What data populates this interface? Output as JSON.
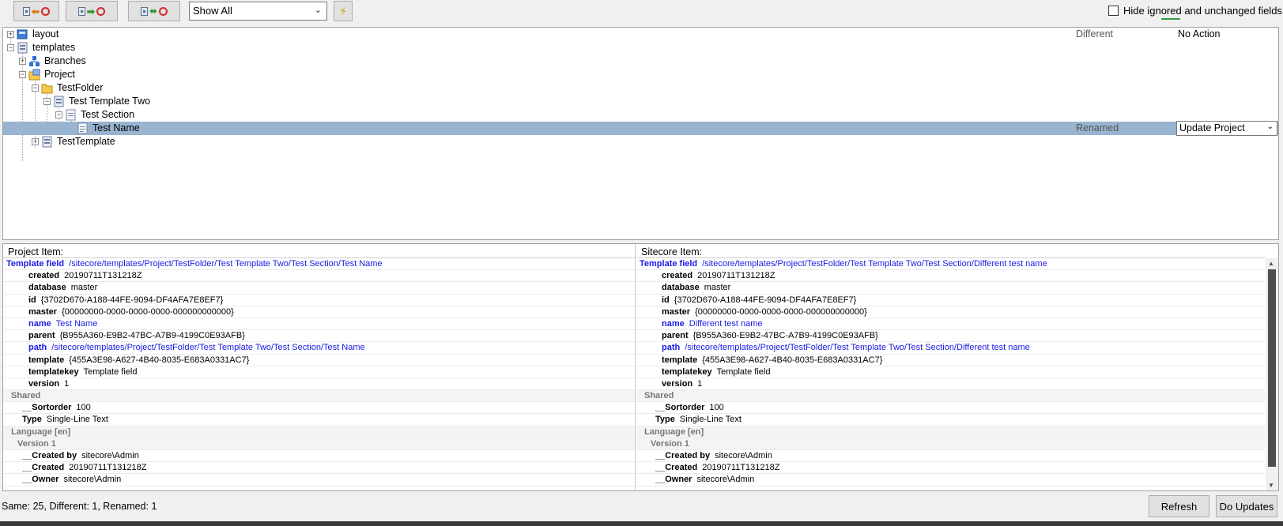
{
  "toolbar": {
    "filter_value": "Show All",
    "hide_label": "Hide ignored and unchanged fields"
  },
  "tree": {
    "rows": [
      {
        "label": "layout",
        "status": "Different",
        "action": "No Action"
      },
      {
        "label": "templates"
      },
      {
        "label": "Branches"
      },
      {
        "label": "Project"
      },
      {
        "label": "TestFolder"
      },
      {
        "label": "Test Template Two"
      },
      {
        "label": "Test Section"
      },
      {
        "label": "Test Name",
        "status": "Renamed",
        "action": "Update Project"
      },
      {
        "label": "TestTemplate"
      }
    ]
  },
  "left": {
    "header": "Project Item:",
    "rows": [
      {
        "k": "Template field",
        "v": "/sitecore/templates/Project/TestFolder/Test Template Two/Test Section/Test Name"
      },
      {
        "k": "created",
        "v": "20190711T131218Z"
      },
      {
        "k": "database",
        "v": "master"
      },
      {
        "k": "id",
        "v": "{3702D670-A188-44FE-9094-DF4AFA7E8EF7}"
      },
      {
        "k": "master",
        "v": "{00000000-0000-0000-0000-000000000000}"
      },
      {
        "k": "name",
        "v": "Test Name"
      },
      {
        "k": "parent",
        "v": "{B955A360-E9B2-47BC-A7B9-4199C0E93AFB}"
      },
      {
        "k": "path",
        "v": "/sitecore/templates/Project/TestFolder/Test Template Two/Test Section/Test Name"
      },
      {
        "k": "template",
        "v": "{455A3E98-A627-4B40-8035-E683A0331AC7}"
      },
      {
        "k": "templatekey",
        "v": "Template field"
      },
      {
        "k": "version",
        "v": "1"
      },
      {
        "k": "Shared",
        "v": ""
      },
      {
        "k": "__Sortorder",
        "v": "100"
      },
      {
        "k": "Type",
        "v": "Single-Line Text"
      },
      {
        "k": "Language [en]",
        "v": ""
      },
      {
        "k": "Version 1",
        "v": ""
      },
      {
        "k": "__Created by",
        "v": "sitecore\\Admin"
      },
      {
        "k": "__Created",
        "v": "20190711T131218Z"
      },
      {
        "k": "__Owner",
        "v": "sitecore\\Admin"
      }
    ]
  },
  "right": {
    "header": "Sitecore Item:",
    "rows": [
      {
        "k": "Template field",
        "v": "/sitecore/templates/Project/TestFolder/Test Template Two/Test Section/Different test name"
      },
      {
        "k": "created",
        "v": "20190711T131218Z"
      },
      {
        "k": "database",
        "v": "master"
      },
      {
        "k": "id",
        "v": "{3702D670-A188-44FE-9094-DF4AFA7E8EF7}"
      },
      {
        "k": "master",
        "v": "{00000000-0000-0000-0000-000000000000}"
      },
      {
        "k": "name",
        "v": "Different test name"
      },
      {
        "k": "parent",
        "v": "{B955A360-E9B2-47BC-A7B9-4199C0E93AFB}"
      },
      {
        "k": "path",
        "v": "/sitecore/templates/Project/TestFolder/Test Template Two/Test Section/Different test name"
      },
      {
        "k": "template",
        "v": "{455A3E98-A627-4B40-8035-E683A0331AC7}"
      },
      {
        "k": "templatekey",
        "v": "Template field"
      },
      {
        "k": "version",
        "v": "1"
      },
      {
        "k": "Shared",
        "v": ""
      },
      {
        "k": "__Sortorder",
        "v": "100"
      },
      {
        "k": "Type",
        "v": "Single-Line Text"
      },
      {
        "k": "Language [en]",
        "v": ""
      },
      {
        "k": "Version 1",
        "v": ""
      },
      {
        "k": "__Created by",
        "v": "sitecore\\Admin"
      },
      {
        "k": "__Created",
        "v": "20190711T131218Z"
      },
      {
        "k": "__Owner",
        "v": "sitecore\\Admin"
      }
    ]
  },
  "status": {
    "summary": "Same: 25, Different: 1, Renamed: 1",
    "refresh_label": "Refresh",
    "do_updates_label": "Do Updates"
  }
}
